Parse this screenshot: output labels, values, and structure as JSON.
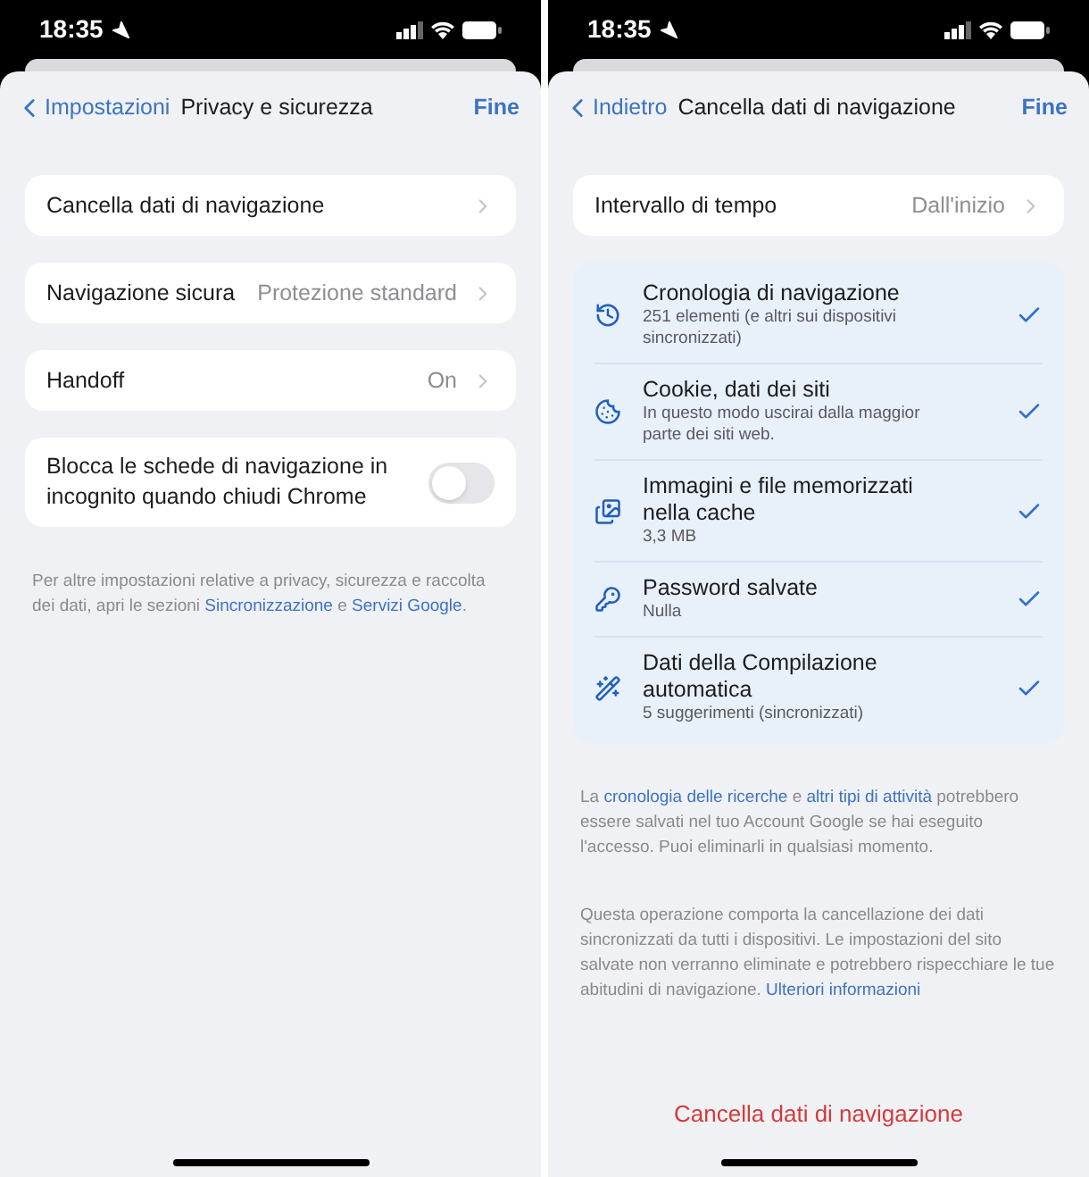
{
  "phones": [
    {
      "status": {
        "time": "18:35"
      },
      "nav": {
        "back": "Impostazioni",
        "title": "Privacy e sicurezza",
        "done": "Fine"
      },
      "rows": [
        {
          "kind": "link",
          "label": "Cancella dati di navigazione"
        },
        {
          "kind": "link",
          "label": "Navigazione sicura",
          "value": "Protezione standard"
        },
        {
          "kind": "link",
          "label": "Handoff",
          "value": "On"
        },
        {
          "kind": "toggle",
          "label": "Blocca le schede di navigazione in incognito quando chiudi Chrome",
          "on": false
        }
      ],
      "notes": [
        [
          {
            "text": "Per altre impostazioni relative a privacy, sicurezza e raccolta dei dati, apri le sezioni "
          },
          {
            "text": "Sincronizzazione",
            "link": true
          },
          {
            "text": " e "
          },
          {
            "text": "Servizi Google",
            "link": true
          },
          {
            "text": "."
          }
        ]
      ]
    },
    {
      "status": {
        "time": "18:35"
      },
      "nav": {
        "back": "Indietro",
        "title": "Cancella dati di navigazione",
        "done": "Fine"
      },
      "rows": [
        {
          "kind": "link",
          "label": "Intervallo di tempo",
          "value": "Dall'inizio"
        }
      ],
      "options": [
        {
          "kind": "history",
          "title": "Cronologia di navigazione",
          "subtitle": "251 elementi (e altri sui dispositivi sincronizzati)",
          "checked": true
        },
        {
          "kind": "cookie",
          "title": "Cookie, dati dei siti",
          "subtitle": "In questo modo uscirai dalla maggior parte dei siti web.",
          "checked": true
        },
        {
          "kind": "images",
          "title": "Immagini e file memorizzati nella cache",
          "subtitle": "3,3 MB",
          "checked": true
        },
        {
          "kind": "key",
          "title": "Password salvate",
          "subtitle": "Nulla",
          "checked": true
        },
        {
          "kind": "wand",
          "title": "Dati della Compilazione automatica",
          "subtitle": "5 suggerimenti (sincronizzati)",
          "checked": true
        }
      ],
      "notes": [
        [
          {
            "text": "La "
          },
          {
            "text": "cronologia delle ricerche",
            "link": true
          },
          {
            "text": " e "
          },
          {
            "text": "altri tipi di attività",
            "link": true
          },
          {
            "text": " potrebbero essere salvati nel tuo Account Google se hai eseguito l'accesso. Puoi eliminarli in qualsiasi momento."
          }
        ],
        [
          {
            "text": "Questa operazione comporta la cancellazione dei dati sincronizzati da tutti i dispositivi. Le impostazioni del sito salvate non verranno eliminate e potrebbero rispecchiare le tue abitudini di navigazione. "
          },
          {
            "text": "Ulteriori informazioni",
            "link": true
          }
        ]
      ],
      "action": "Cancella dati di navigazione"
    }
  ]
}
